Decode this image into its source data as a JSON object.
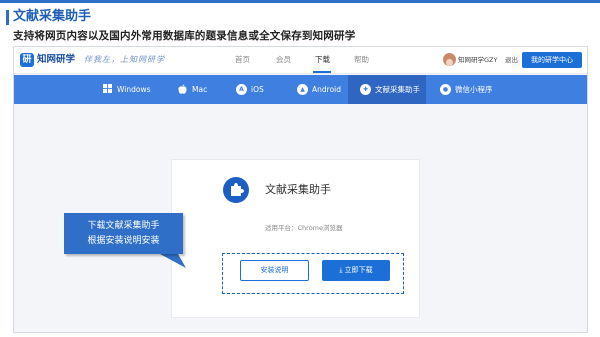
{
  "slide": {
    "title": "文献采集助手",
    "subtitle": "支持将网页内容以及国内外常用数据库的题录信息或全文保存到知网研学"
  },
  "header": {
    "logo_text": "知网研学",
    "slogan": "伴我左，上知网研学",
    "nav": [
      "首页",
      "会员",
      "下载",
      "帮助"
    ],
    "active_nav": "下载",
    "username": "知网研学GZY",
    "logout": "退出",
    "center_button": "我的研学中心"
  },
  "tabs": [
    {
      "label": "Windows",
      "icon": "windows-icon"
    },
    {
      "label": "Mac",
      "icon": "apple-icon"
    },
    {
      "label": "iOS",
      "icon": "app-store-icon"
    },
    {
      "label": "Android",
      "icon": "android-icon"
    },
    {
      "label": "文献采集助手",
      "icon": "puzzle-icon",
      "active": true
    },
    {
      "label": "微信小程序",
      "icon": "wechat-icon"
    }
  ],
  "card": {
    "title": "文献采集助手",
    "platform": "适用平台：Chrome浏览器",
    "guide_button": "安装说明",
    "download_button": "立即下载"
  },
  "callout": {
    "line1": "下载文献采集助手",
    "line2": "根据安装说明安装"
  },
  "colors": {
    "brand_blue": "#1d6fd8",
    "tab_bar": "#3f7fe0",
    "slide_accent": "#2f6fc8"
  }
}
